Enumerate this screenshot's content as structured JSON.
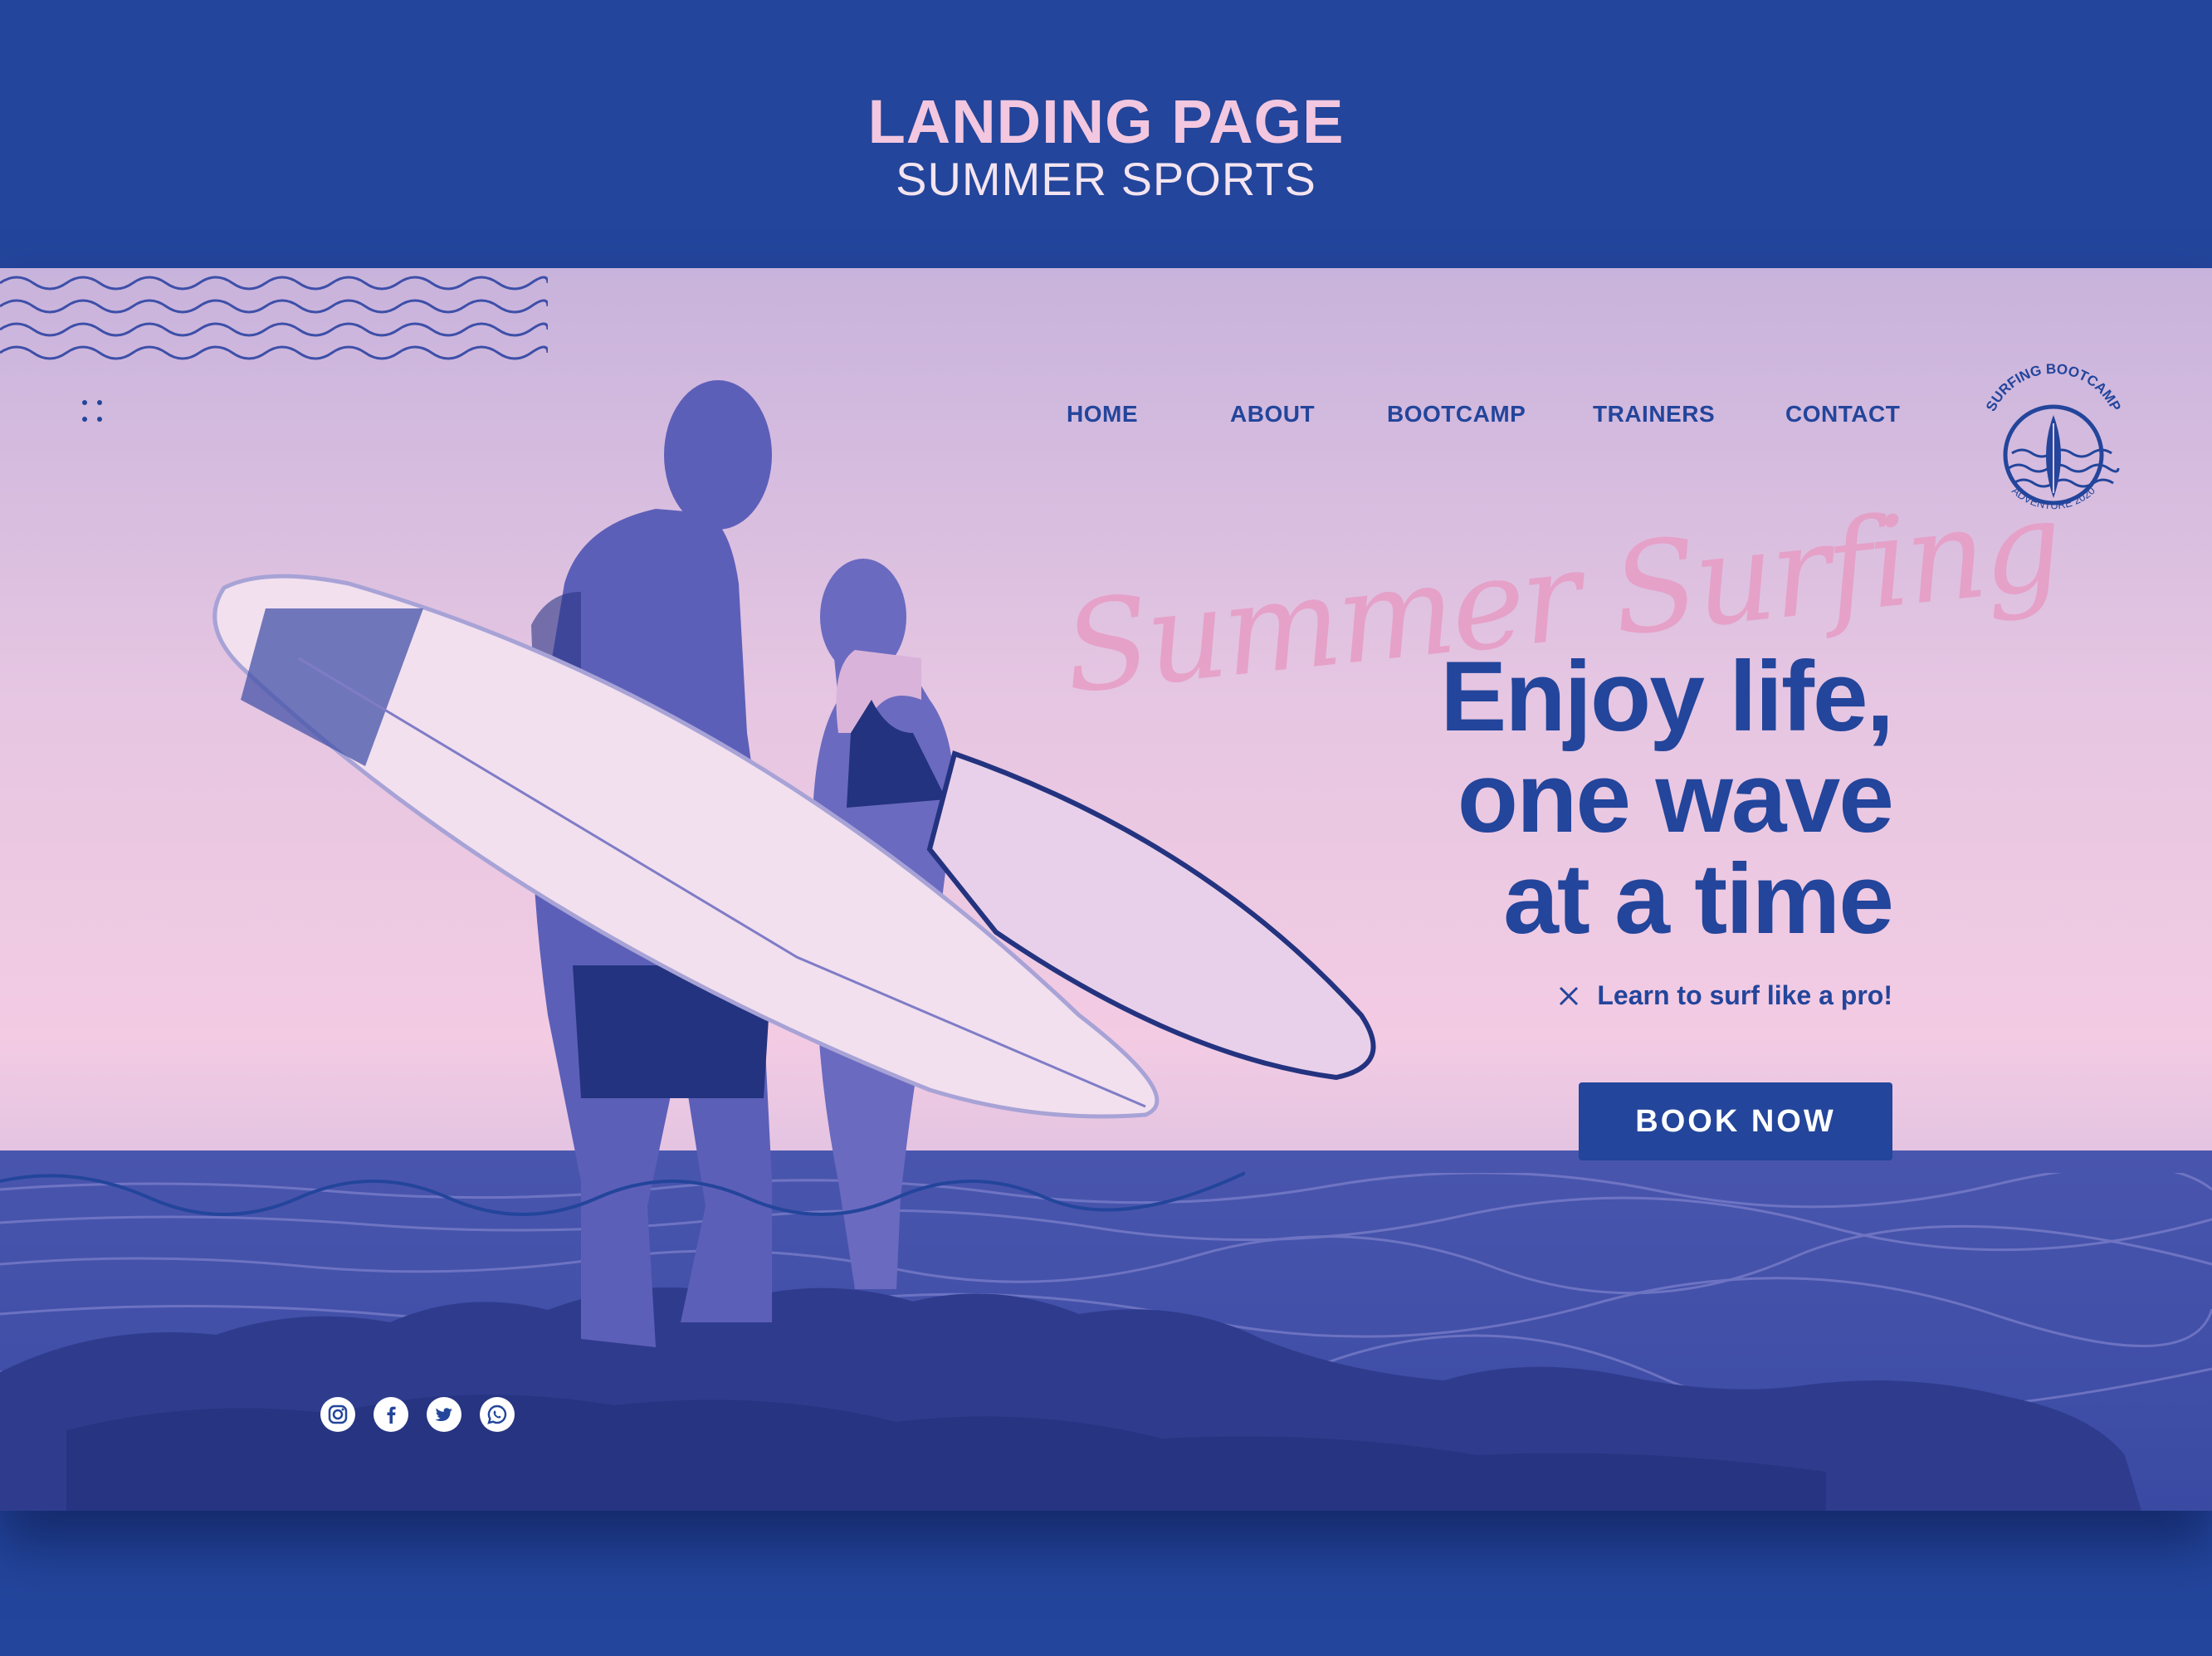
{
  "header": {
    "title": "LANDING PAGE",
    "subtitle": "SUMMER SPORTS"
  },
  "nav": {
    "items": [
      {
        "label": "HOME"
      },
      {
        "label": "ABOUT"
      },
      {
        "label": "BOOTCAMP"
      },
      {
        "label": "TRAINERS"
      },
      {
        "label": "CONTACT"
      }
    ]
  },
  "badge": {
    "top_text": "SURFING BOOTCAMP",
    "bottom_text": "ADVENTURE 2020"
  },
  "hero": {
    "script": "Summer Surfing",
    "headline": [
      "Enjoy life,",
      "one wave",
      "at a time"
    ],
    "tagline": "Learn to surf like a pro!",
    "cta": "BOOK NOW"
  },
  "socials": [
    "instagram-icon",
    "facebook-icon",
    "twitter-icon",
    "whatsapp-icon"
  ],
  "colors": {
    "brand": "#23459b",
    "pink": "#f2c7df",
    "accent_pink": "#e79cc4"
  }
}
